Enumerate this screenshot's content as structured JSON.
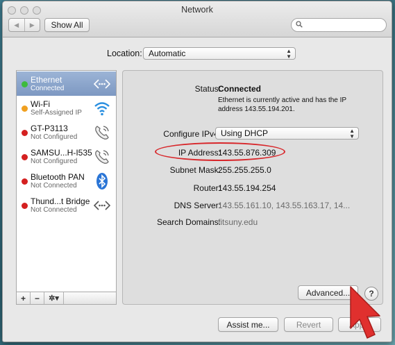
{
  "window": {
    "title": "Network"
  },
  "toolbar": {
    "show_all_label": "Show All",
    "search_placeholder": ""
  },
  "location": {
    "label": "Location:",
    "value": "Automatic"
  },
  "services": [
    {
      "name": "Ethernet",
      "status": "Connected",
      "dot_color": "#3dbb3d",
      "icon": "ethernet-icon",
      "selected": true
    },
    {
      "name": "Wi-Fi",
      "status": "Self-Assigned IP",
      "dot_color": "#f0a020",
      "icon": "wifi-icon",
      "selected": false
    },
    {
      "name": "GT-P3113",
      "status": "Not Configured",
      "dot_color": "#d42020",
      "icon": "phone-icon",
      "selected": false
    },
    {
      "name": "SAMSU...H-I535",
      "status": "Not Configured",
      "dot_color": "#d42020",
      "icon": "phone-icon",
      "selected": false
    },
    {
      "name": "Bluetooth PAN",
      "status": "Not Connected",
      "dot_color": "#d42020",
      "icon": "bluetooth-icon",
      "selected": false
    },
    {
      "name": "Thund...t Bridge",
      "status": "Not Connected",
      "dot_color": "#d42020",
      "icon": "ethernet-icon",
      "selected": false
    }
  ],
  "sidebar_tools": {
    "add": "+",
    "remove": "−",
    "gear": "✲▾"
  },
  "details": {
    "status_label": "Status:",
    "status_value": "Connected",
    "status_description": "Ethernet is currently active and has the IP address 143.55.194.201.",
    "configure_label": "Configure IPv4:",
    "configure_value": "Using DHCP",
    "ip_label": "IP Address:",
    "ip_value": "143.55.876.309",
    "subnet_label": "Subnet Mask:",
    "subnet_value": "255.255.255.0",
    "router_label": "Router:",
    "router_value": "143.55.194.254",
    "dns_label": "DNS Server:",
    "dns_value": "143.55.161.10, 143.55.163.17, 14...",
    "search_label": "Search Domains:",
    "search_value": "fitsuny.edu"
  },
  "buttons": {
    "advanced": "Advanced...",
    "help": "?",
    "assist": "Assist me...",
    "revert": "Revert",
    "apply": "Apply"
  },
  "colors": {
    "highlight": "#d8262a",
    "selected_row": "#8aa5cc",
    "cursor": "#e0302e"
  }
}
